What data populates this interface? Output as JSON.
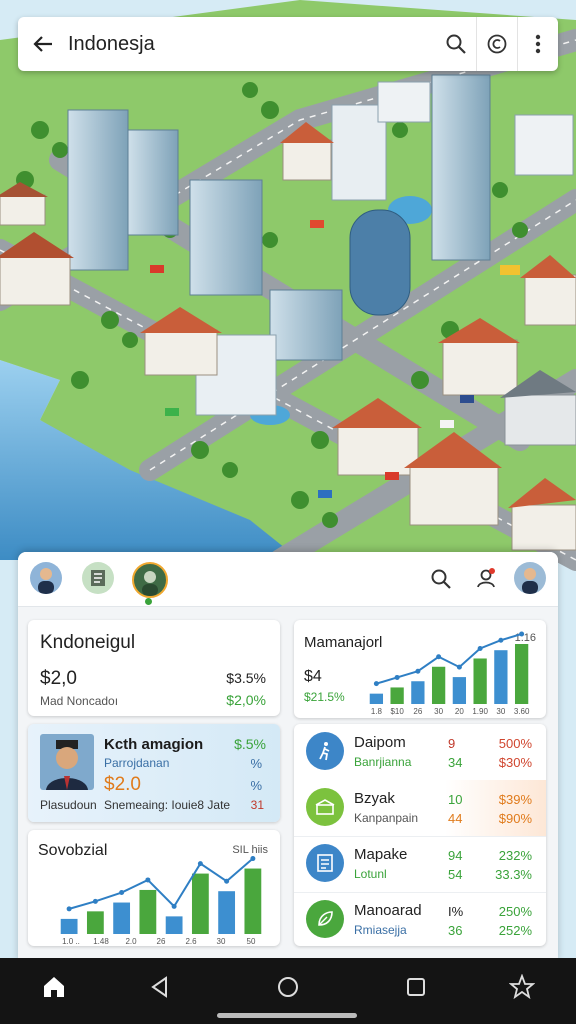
{
  "header": {
    "title": "Indonesja"
  },
  "panel": {
    "card_left_top": {
      "title": "Kndoneigul",
      "value": "$2,0",
      "right_value": "$3.5%",
      "label": "Mad Noncadoı",
      "right_label": "$2,0%"
    },
    "card_person": {
      "name": "Kcth amagion",
      "subtitle": "Parrojdanan",
      "price": "$2.0",
      "right_top": "$.5%",
      "right_mid": "%",
      "right_mid2": "%",
      "caption_left": "Plasudoun",
      "caption_mid": "Snemeaing: Iouie8 Jate",
      "caption_right": "31"
    },
    "card_chart_left": {
      "title": "Sovobzial",
      "tag": "SIL hiis",
      "ticks": [
        "1.0 ..",
        "1.48",
        "2.0",
        "26",
        "2.6",
        "30",
        "50"
      ]
    },
    "card_chart_right": {
      "title": "Mamanajorl",
      "tag": "1:16",
      "value": "$4",
      "percent": "$21.5%",
      "ticks": [
        "1.8",
        "$10",
        "26",
        "30",
        "20",
        "1.90",
        "30",
        "3.60"
      ]
    },
    "list": [
      {
        "name": "Daipom",
        "sub": "Banrjianna",
        "v1": "9",
        "v2": "34",
        "p1": "500%",
        "p2": "$30%",
        "icon": "walking-person-icon",
        "color": "#3d86c8"
      },
      {
        "name": "Bzyak",
        "sub": "Kanpanpain",
        "v1": "10",
        "v2": "44",
        "p1": "$39%",
        "p2": "$90%",
        "icon": "stadium-icon",
        "color": "#7cc23e"
      },
      {
        "name": "Mapake",
        "sub": "Lotunl",
        "v1": "94",
        "v2": "54",
        "p1": "232%",
        "p2": "33.3%",
        "icon": "document-icon",
        "color": "#3d86c8"
      },
      {
        "name": "Manoarad",
        "sub": "Rmiasejja",
        "v1": "I%",
        "v2": "36",
        "p1": "250%",
        "p2": "252%",
        "icon": "leaf-icon",
        "color": "#4aa73d"
      }
    ]
  },
  "chart_data": [
    {
      "type": "bar",
      "title": "Sovobzial",
      "categories": [
        "1.0",
        "1.48",
        "2.0",
        "26",
        "2.6",
        "30",
        "50"
      ],
      "values": [
        12,
        18,
        25,
        35,
        14,
        48,
        34,
        52
      ]
    },
    {
      "type": "bar",
      "title": "Mamanajorl",
      "categories": [
        "1.8",
        "$10",
        "26",
        "30",
        "20",
        "1.90",
        "30",
        "3.60"
      ],
      "values": [
        10,
        16,
        22,
        36,
        26,
        44,
        52,
        58
      ]
    }
  ],
  "colors": {
    "accent_green": "#4aa73d",
    "accent_blue": "#3d86c8",
    "nav_bg": "#141414"
  }
}
